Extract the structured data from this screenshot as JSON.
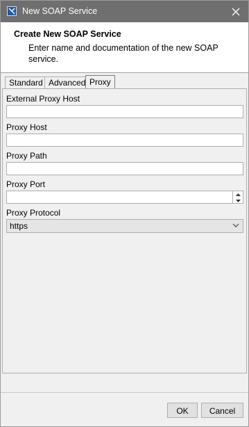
{
  "window": {
    "title": "New SOAP Service",
    "app_icon": "application-icon",
    "close_icon": "close-icon"
  },
  "header": {
    "title": "Create New SOAP Service",
    "description": "Enter name and documentation of the new SOAP service."
  },
  "tabs": [
    {
      "label": "Standard",
      "active": false
    },
    {
      "label": "Advanced",
      "active": false
    },
    {
      "label": "Proxy",
      "active": true
    }
  ],
  "form": {
    "external_proxy_host": {
      "label": "External Proxy Host",
      "value": ""
    },
    "proxy_host": {
      "label": "Proxy Host",
      "value": ""
    },
    "proxy_path": {
      "label": "Proxy Path",
      "value": ""
    },
    "proxy_port": {
      "label": "Proxy Port",
      "value": ""
    },
    "proxy_protocol": {
      "label": "Proxy Protocol",
      "value": "https"
    }
  },
  "buttons": {
    "ok": "OK",
    "cancel": "Cancel"
  }
}
